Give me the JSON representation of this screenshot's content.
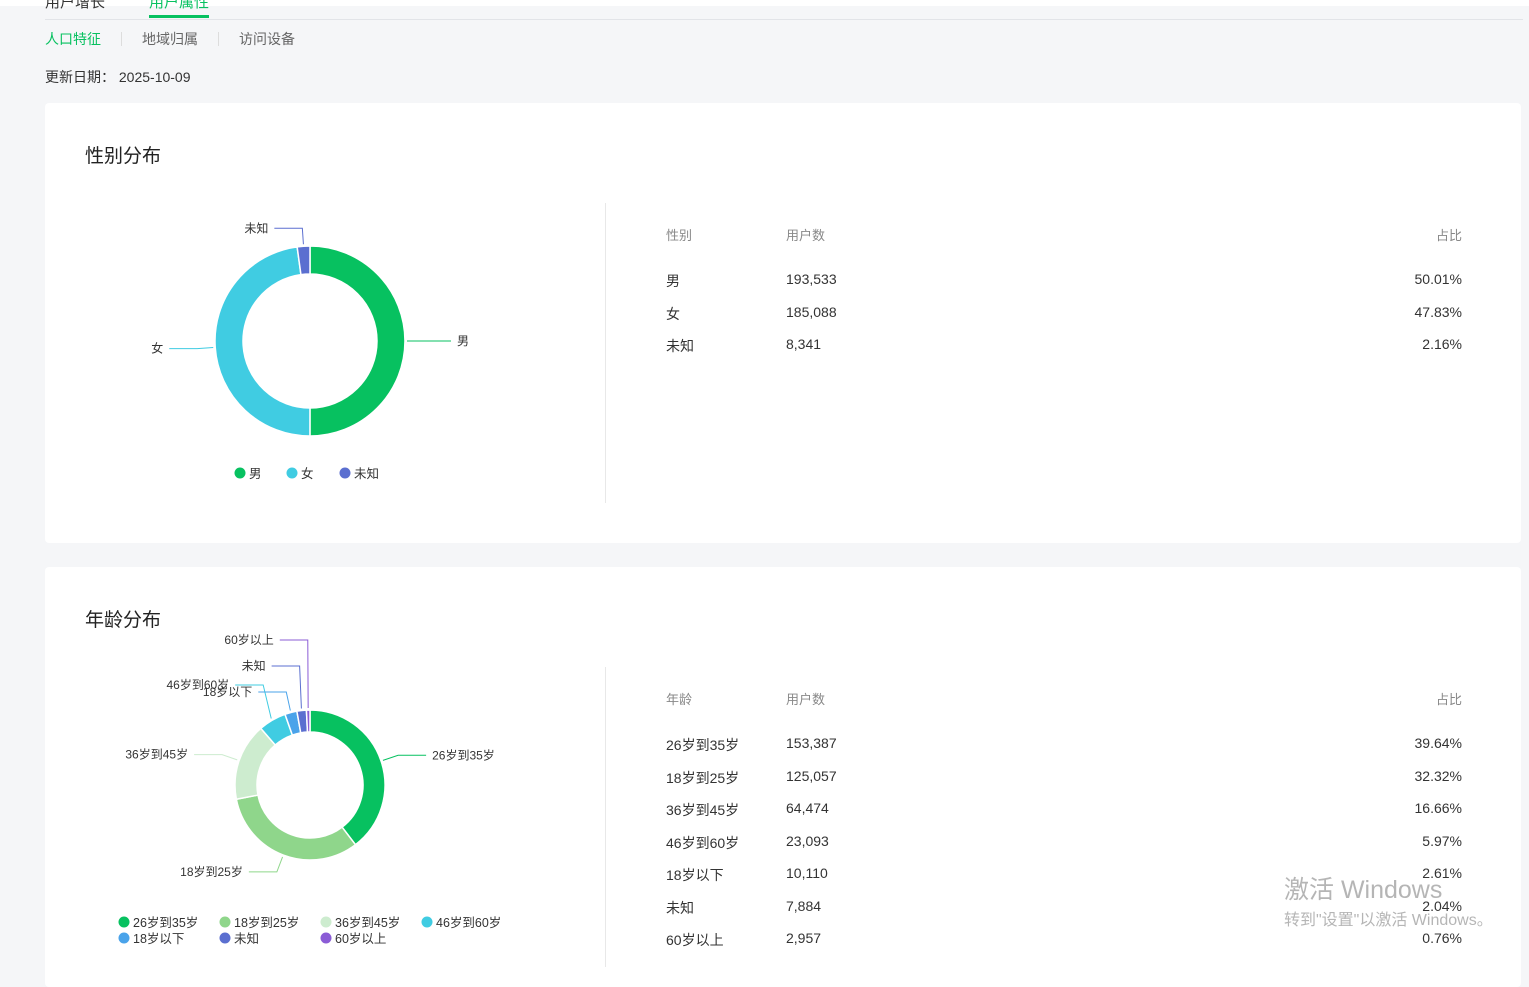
{
  "top_tabs": [
    "用户增长",
    "用户属性"
  ],
  "sub_tabs": [
    "人口特征",
    "地域归属",
    "访问设备"
  ],
  "update_label": "更新日期：",
  "update_date": "2025-10-09",
  "gender": {
    "title": "性别分布",
    "headers": [
      "性别",
      "用户数",
      "占比"
    ],
    "rows": [
      [
        "男",
        "193,533",
        "50.01%"
      ],
      [
        "女",
        "185,088",
        "47.83%"
      ],
      [
        "未知",
        "8,341",
        "2.16%"
      ]
    ]
  },
  "age": {
    "title": "年龄分布",
    "headers": [
      "年龄",
      "用户数",
      "占比"
    ],
    "rows": [
      [
        "26岁到35岁",
        "153,387",
        "39.64%"
      ],
      [
        "18岁到25岁",
        "125,057",
        "32.32%"
      ],
      [
        "36岁到45岁",
        "64,474",
        "16.66%"
      ],
      [
        "46岁到60岁",
        "23,093",
        "5.97%"
      ],
      [
        "18岁以下",
        "10,110",
        "2.61%"
      ],
      [
        "未知",
        "7,884",
        "2.04%"
      ],
      [
        "60岁以上",
        "2,957",
        "0.76%"
      ]
    ]
  },
  "chart_data": [
    {
      "type": "pie",
      "title": "性别分布",
      "categories": [
        "男",
        "女",
        "未知"
      ],
      "values": [
        50.01,
        47.83,
        2.16
      ],
      "colors": [
        "#07c160",
        "#40cce2",
        "#5b6fd0"
      ],
      "legend": "bottom"
    },
    {
      "type": "pie",
      "title": "年龄分布",
      "categories": [
        "26岁到35岁",
        "18岁到25岁",
        "36岁到45岁",
        "46岁到60岁",
        "18岁以下",
        "未知",
        "60岁以上"
      ],
      "values": [
        39.64,
        32.32,
        16.66,
        5.97,
        2.61,
        2.04,
        0.76
      ],
      "colors": [
        "#07c160",
        "#8fd68b",
        "#cdeccf",
        "#40cce2",
        "#4aa3ea",
        "#5b6fd0",
        "#8b5cd6"
      ],
      "legend": "bottom"
    }
  ],
  "watermark": {
    "line1": "激活 Windows",
    "line2": "转到\"设置\"以激活 Windows。"
  }
}
